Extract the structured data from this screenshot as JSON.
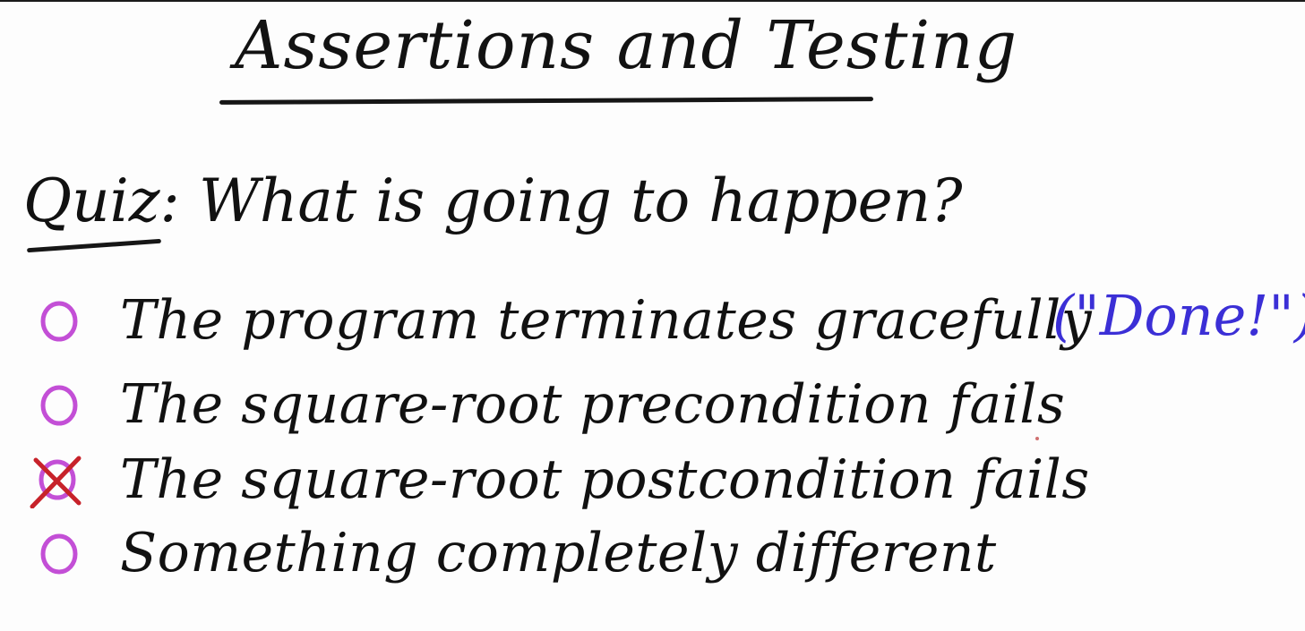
{
  "title": "Assertions and Testing",
  "quiz": {
    "label": "Quiz:",
    "question": "What is going to happen?"
  },
  "options": [
    {
      "label": "The program terminates gracefully",
      "marked": false
    },
    {
      "label": "The square-root precondition fails",
      "marked": false
    },
    {
      "label": "The square-root postcondition fails",
      "marked": true
    },
    {
      "label": "Something completely different",
      "marked": false
    }
  ],
  "annotation": "(\"Done!\")",
  "colors": {
    "ink": "#121212",
    "radio": "#c34fd6",
    "mark": "#c7222a",
    "annotation": "#3b2fd6"
  }
}
